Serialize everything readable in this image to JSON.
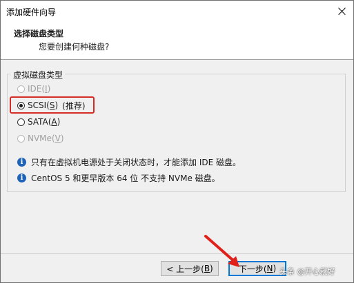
{
  "window": {
    "title": "添加硬件向导",
    "close_glyph": "✕"
  },
  "header": {
    "title": "选择磁盘类型",
    "subtitle": "您要创建何种磁盘?"
  },
  "group": {
    "label": "虚拟磁盘类型",
    "options": [
      {
        "label": "IDE(I)",
        "prefix": "IDE(",
        "accel": "I",
        "suffix": ")",
        "enabled": false,
        "checked": false
      },
      {
        "label": "SCSI(S)",
        "prefix": "SCSI(",
        "accel": "S",
        "suffix": ")",
        "note": "(推荐)",
        "enabled": true,
        "checked": true
      },
      {
        "label": "SATA(A)",
        "prefix": "SATA(",
        "accel": "A",
        "suffix": ")",
        "enabled": true,
        "checked": false
      },
      {
        "label": "NVMe(V)",
        "prefix": "NVMe(",
        "accel": "V",
        "suffix": ")",
        "enabled": false,
        "checked": false
      }
    ]
  },
  "info": [
    {
      "icon": "info-icon",
      "text": "只有在虚拟机电源处于关闭状态时，才能添加 IDE 磁盘。"
    },
    {
      "icon": "info-icon",
      "text": "CentOS 5 和更早版本 64 位 不支持 NVMe 磁盘。"
    }
  ],
  "buttons": {
    "back": {
      "prefix": "< 上一步(",
      "accel": "B",
      "suffix": ")"
    },
    "next": {
      "prefix": "下一步(",
      "accel": "N",
      "suffix": ")"
    }
  },
  "watermark": "头条 @开心就好",
  "colors": {
    "highlight": "#d62b24",
    "info_icon": "#1f63b8",
    "primary_border": "#0078d7"
  }
}
